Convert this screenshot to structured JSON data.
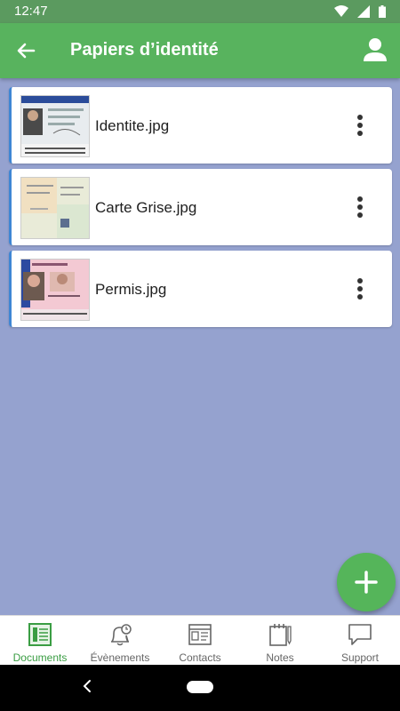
{
  "status": {
    "time": "12:47"
  },
  "appbar": {
    "title": "Papiers d’identité"
  },
  "documents": [
    {
      "name": "Identite.jpg"
    },
    {
      "name": "Carte Grise.jpg"
    },
    {
      "name": "Permis.jpg"
    }
  ],
  "bottom_nav": {
    "items": [
      {
        "label": "Documents",
        "icon": "documents-icon"
      },
      {
        "label": "Évènements",
        "icon": "alarm-bell-icon"
      },
      {
        "label": "Contacts",
        "icon": "contact-card-icon"
      },
      {
        "label": "Notes",
        "icon": "notepad-icon"
      },
      {
        "label": "Support",
        "icon": "chat-bubble-icon"
      }
    ],
    "active_index": 0
  },
  "colors": {
    "statusbar": "#5b9a5f",
    "appbar": "#58b35e",
    "background": "#95a2cf",
    "fab": "#55b55a",
    "active_nav": "#3a9d43"
  }
}
